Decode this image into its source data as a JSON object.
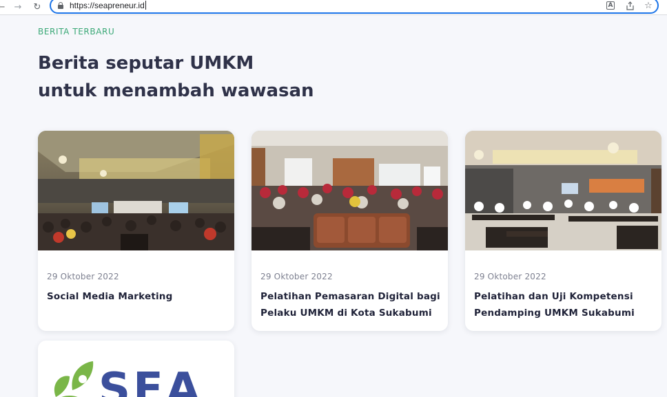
{
  "browser": {
    "url": "https://seapreneur.id",
    "icons": {
      "back": "arrow-left-icon",
      "forward": "arrow-right-icon",
      "reload": "reload-icon",
      "lock": "lock-icon",
      "translate": "translate-icon",
      "share": "share-icon",
      "bookmark": "star-icon"
    }
  },
  "section": {
    "kicker": "BERITA TERBARU",
    "title_line1": "Berita seputar UMKM",
    "title_line2": "untuk menambah wawasan"
  },
  "news": [
    {
      "date": "29 Oktober 2022",
      "title": "Social Media Marketing"
    },
    {
      "date": "29 Oktober 2022",
      "title": "Pelatihan Pemasaran Digital bagi Pelaku UMKM di Kota Sukabumi"
    },
    {
      "date": "29 Oktober 2022",
      "title": "Pelatihan dan Uji Kompetensi Pendamping UMKM Sukabumi"
    }
  ],
  "logo_card": {
    "logo_text": "SEA"
  },
  "colors": {
    "accent_green": "#3aa876",
    "heading": "#2f3249",
    "background": "#f6f7fb",
    "focus_ring": "#1a73e8",
    "logo_blue": "#3b4f9c",
    "logo_green": "#7ab648"
  }
}
